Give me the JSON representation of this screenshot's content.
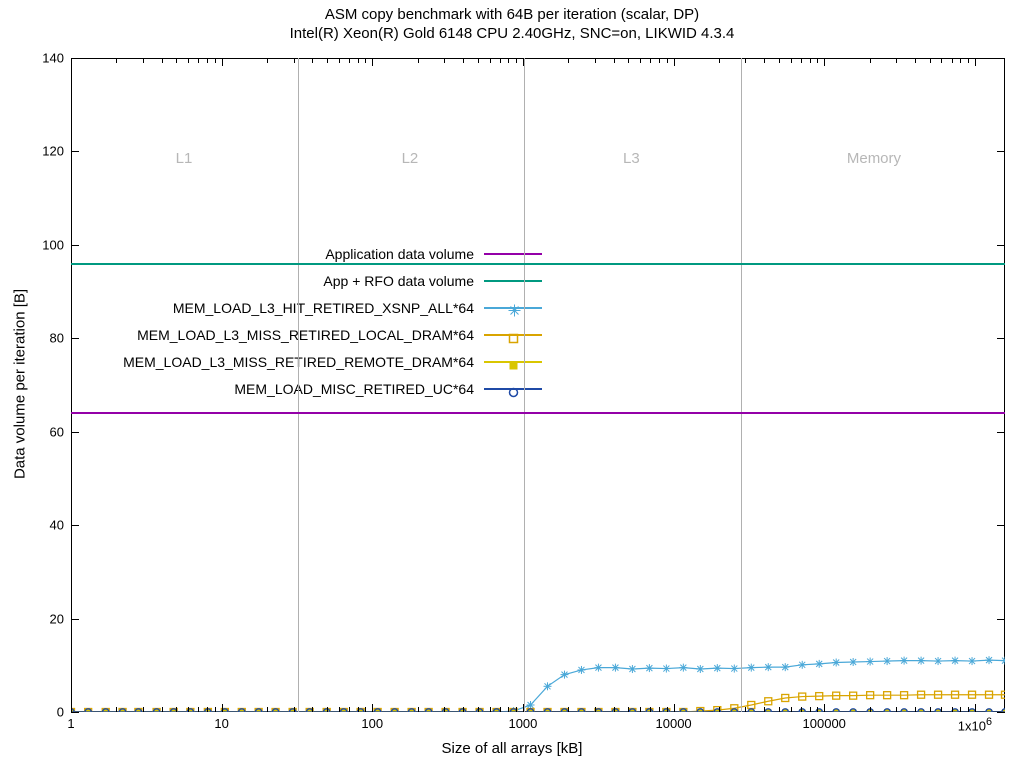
{
  "title": "ASM copy benchmark with 64B per iteration (scalar, DP)",
  "subtitle": "Intel(R) Xeon(R) Gold 6148 CPU 2.40GHz, SNC=on, LIKWID 4.3.4",
  "xlabel": "Size of all arrays [kB]",
  "ylabel": "Data volume per iteration [B]",
  "y_ticks": [
    0,
    20,
    40,
    60,
    80,
    100,
    120,
    140
  ],
  "y_range": [
    0,
    140
  ],
  "x_major_ticks": [
    1,
    10,
    100,
    1000,
    10000,
    100000,
    1000000
  ],
  "x_major_labels": [
    "1",
    "10",
    "100",
    "1000",
    "10000",
    "100000",
    "1x10"
  ],
  "x_major_last_exp": "6",
  "x_range_log10": [
    0,
    6.2
  ],
  "regions": {
    "dividers_kB": [
      32,
      1024,
      28160
    ],
    "labels": [
      {
        "text": "L1",
        "at_log10": 0.75
      },
      {
        "text": "L2",
        "at_log10": 2.25
      },
      {
        "text": "L3",
        "at_log10": 3.72
      },
      {
        "text": "Memory",
        "at_log10": 5.33
      }
    ]
  },
  "ref_lines": {
    "app_data_volume": {
      "value": 64,
      "color": "#9400a8"
    },
    "app_plus_rfo": {
      "value": 96,
      "color": "#009980"
    }
  },
  "legend": [
    {
      "label": "Application data volume",
      "type": "line",
      "color": "#9400a8"
    },
    {
      "label": "App + RFO data volume",
      "type": "line",
      "color": "#009980"
    },
    {
      "label": "MEM_LOAD_L3_HIT_RETIRED_XSNP_ALL*64",
      "type": "series",
      "color": "#4aa8d8",
      "marker": "asterisk"
    },
    {
      "label": "MEM_LOAD_L3_MISS_RETIRED_LOCAL_DRAM*64",
      "type": "series",
      "color": "#d9a400",
      "marker": "open-square"
    },
    {
      "label": "MEM_LOAD_L3_MISS_RETIRED_REMOTE_DRAM*64",
      "type": "series",
      "color": "#d9c600",
      "marker": "solid-square"
    },
    {
      "label": "MEM_LOAD_MISC_RETIRED_UC*64",
      "type": "series",
      "color": "#1f4aa6",
      "marker": "open-circle"
    }
  ],
  "chart_data": {
    "type": "line",
    "x_scale": "log",
    "x_unit": "kB",
    "title": "ASM copy benchmark with 64B per iteration (scalar, DP)",
    "subtitle": "Intel(R) Xeon(R) Gold 6148 CPU 2.40GHz, SNC=on, LIKWID 4.3.4",
    "xlabel": "Size of all arrays [kB]",
    "ylabel": "Data volume per iteration [B]",
    "ylim": [
      0,
      140
    ],
    "xlim": [
      1,
      1585000
    ],
    "reference_lines": [
      {
        "name": "Application data volume",
        "y": 64
      },
      {
        "name": "App + RFO data volume",
        "y": 96
      }
    ],
    "x": [
      1,
      1.3,
      1.7,
      2.2,
      2.8,
      3.7,
      4.8,
      6.2,
      8.1,
      10.5,
      13.6,
      17.6,
      22.8,
      29.6,
      38.4,
      49.8,
      64.6,
      83.7,
      108.5,
      140.7,
      182.4,
      236.5,
      306.6,
      397.5,
      515.3,
      668,
      866,
      1123,
      1456,
      1887,
      2446,
      3171,
      4111,
      5329,
      6908,
      8955,
      11609,
      15049,
      19510,
      25293,
      32789,
      42510,
      55107,
      71442,
      92612,
      120054,
      155624,
      201736,
      261514,
      339007,
      439508,
      569800,
      738715,
      957695,
      1241530,
      1585000
    ],
    "series": [
      {
        "name": "MEM_LOAD_L3_HIT_RETIRED_XSNP_ALL*64",
        "color": "#4aa8d8",
        "values": [
          0,
          0,
          0,
          0,
          0,
          0,
          0,
          0,
          0,
          0,
          0,
          0,
          0,
          0,
          0,
          0,
          0,
          0,
          0,
          0,
          0,
          0,
          0,
          0,
          0,
          0,
          0.2,
          1.5,
          5.5,
          8,
          9,
          9.5,
          9.5,
          9.2,
          9.4,
          9.3,
          9.5,
          9.2,
          9.4,
          9.3,
          9.5,
          9.6,
          9.6,
          10.1,
          10.3,
          10.6,
          10.7,
          10.8,
          10.9,
          11.0,
          11.0,
          10.9,
          11.0,
          10.9,
          11.1,
          11.0
        ]
      },
      {
        "name": "MEM_LOAD_L3_MISS_RETIRED_LOCAL_DRAM*64",
        "color": "#d9a400",
        "values": [
          0,
          0,
          0,
          0,
          0,
          0,
          0,
          0,
          0,
          0,
          0,
          0,
          0,
          0,
          0,
          0,
          0,
          0,
          0,
          0,
          0,
          0,
          0,
          0,
          0,
          0,
          0,
          0,
          0,
          0,
          0,
          0,
          0,
          0,
          0,
          0,
          0,
          0.2,
          0.4,
          0.8,
          1.5,
          2.3,
          3.0,
          3.3,
          3.4,
          3.5,
          3.5,
          3.6,
          3.6,
          3.6,
          3.7,
          3.7,
          3.7,
          3.7,
          3.7,
          3.7
        ]
      },
      {
        "name": "MEM_LOAD_L3_MISS_RETIRED_REMOTE_DRAM*64",
        "color": "#d9c600",
        "values": [
          0,
          0,
          0,
          0,
          0,
          0,
          0,
          0,
          0,
          0,
          0,
          0,
          0,
          0,
          0,
          0,
          0,
          0,
          0,
          0,
          0,
          0,
          0,
          0,
          0,
          0,
          0,
          0,
          0,
          0,
          0,
          0,
          0,
          0,
          0,
          0,
          0,
          0,
          0,
          0,
          0,
          0,
          0,
          0,
          0,
          0,
          0,
          0,
          0,
          0,
          0,
          0,
          0,
          0,
          0,
          0
        ]
      },
      {
        "name": "MEM_LOAD_MISC_RETIRED_UC*64",
        "color": "#1f4aa6",
        "values": [
          0,
          0,
          0,
          0,
          0,
          0,
          0,
          0,
          0,
          0,
          0,
          0,
          0,
          0,
          0,
          0,
          0,
          0,
          0,
          0,
          0,
          0,
          0,
          0,
          0,
          0,
          0,
          0,
          0,
          0,
          0,
          0,
          0,
          0,
          0,
          0,
          0,
          0,
          0,
          0,
          0,
          0,
          0,
          0,
          0,
          0,
          0,
          0,
          0,
          0,
          0,
          0,
          0,
          0,
          0,
          0
        ]
      }
    ]
  }
}
